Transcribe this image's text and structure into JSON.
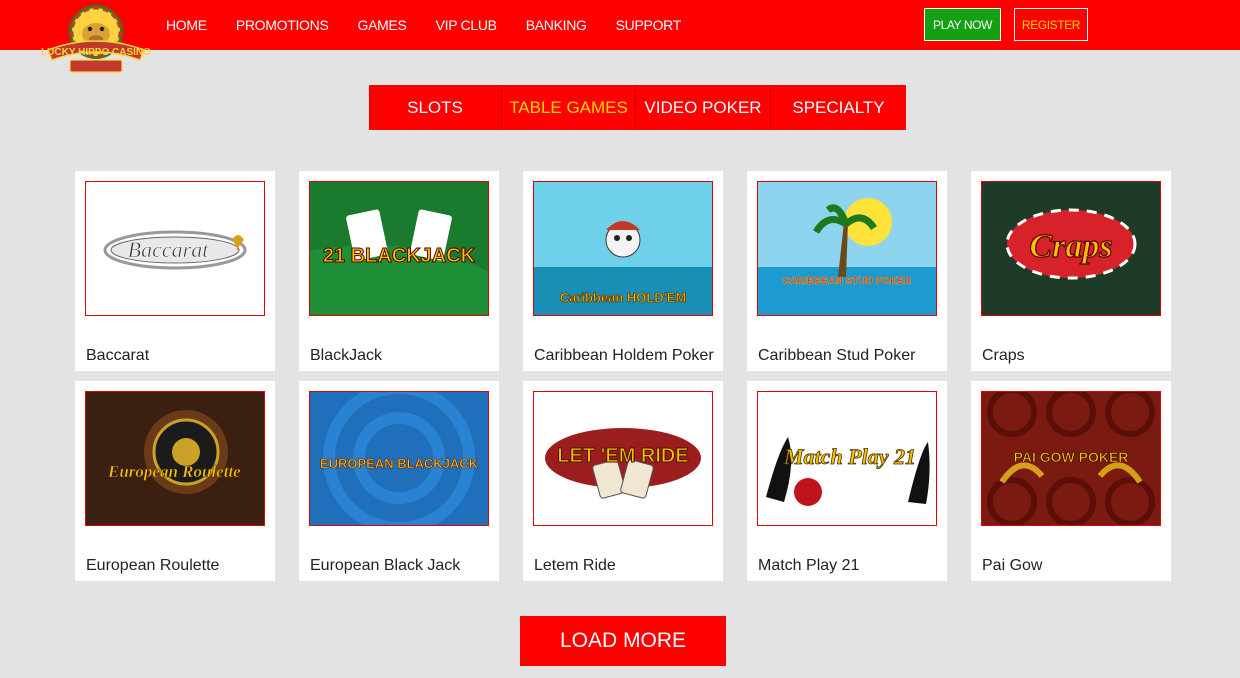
{
  "header": {
    "logo_text": "LUCKY HIPPO CASINO",
    "nav": [
      "HOME",
      "PROMOTIONS",
      "GAMES",
      "VIP CLUB",
      "BANKING",
      "SUPPORT"
    ],
    "play_now": "PLAY NOW",
    "register": "REGISTER"
  },
  "tabs": [
    "SLOTS",
    "TABLE GAMES",
    "VIDEO POKER",
    "SPECIALTY"
  ],
  "active_tab": "TABLE GAMES",
  "games": [
    {
      "title": "Baccarat",
      "art": "Baccarat"
    },
    {
      "title": "BlackJack",
      "art": "21 BLACKJACK"
    },
    {
      "title": "Caribbean Holdem Poker",
      "art": "Caribbean HOLD'EM"
    },
    {
      "title": "Caribbean Stud Poker",
      "art": "CARIBBEAN STUD POKER"
    },
    {
      "title": "Craps",
      "art": "Craps"
    },
    {
      "title": "European Roulette",
      "art": "European Roulette"
    },
    {
      "title": "European Black Jack",
      "art": "EUROPEAN BLACKJACK"
    },
    {
      "title": "Letem Ride",
      "art": "LET 'EM RIDE"
    },
    {
      "title": "Match Play 21",
      "art": "Match Play 21"
    },
    {
      "title": "Pai Gow",
      "art": "PAI GOW POKER"
    }
  ],
  "load_more": "LOAD MORE",
  "colors": {
    "brand_red": "#fe0000",
    "accent_gold": "#ffd700",
    "play_green": "#13a013",
    "background": "#e3e3e3"
  }
}
